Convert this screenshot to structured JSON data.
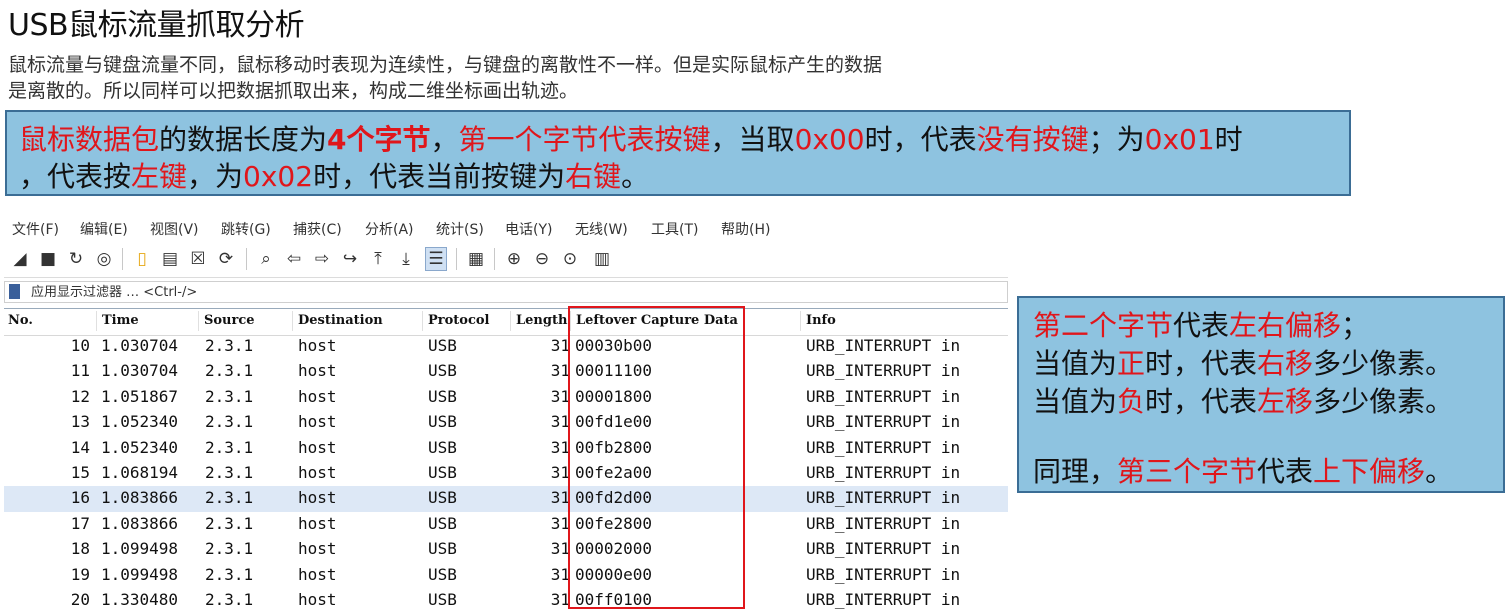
{
  "slide": {
    "title": "USB鼠标流量抓取分析",
    "intro_line1": "鼠标流量与键盘流量不同，鼠标移动时表现为连续性，与键盘的离散性不一样。但是实际鼠标产生的数据",
    "intro_line2": "是离散的。所以同样可以把数据抓取出来，构成二维坐标画出轨迹。"
  },
  "callout1": {
    "line1": [
      {
        "t": "鼠标数据包",
        "red": true
      },
      {
        "t": "的数据长度为",
        "red": false
      },
      {
        "t": "4个字节",
        "red": true,
        "bold": true
      },
      {
        "t": "，",
        "red": false
      },
      {
        "t": "第一个字节代表按键",
        "red": true
      },
      {
        "t": "，当取",
        "red": false
      },
      {
        "t": "0x00",
        "red": true
      },
      {
        "t": "时，代表",
        "red": false
      },
      {
        "t": "没有按键",
        "red": true
      },
      {
        "t": "；为",
        "red": false
      },
      {
        "t": "0x01",
        "red": true
      },
      {
        "t": "时",
        "red": false
      }
    ],
    "line2": [
      {
        "t": "，代表按",
        "red": false
      },
      {
        "t": "左键",
        "red": true
      },
      {
        "t": "，为",
        "red": false
      },
      {
        "t": "0x02",
        "red": true
      },
      {
        "t": "时，代表当前按键为",
        "red": false
      },
      {
        "t": "右键",
        "red": true
      },
      {
        "t": "。",
        "red": false
      }
    ]
  },
  "callout2": {
    "line1": [
      {
        "t": "第二个字节",
        "red": true
      },
      {
        "t": "代表",
        "red": false
      },
      {
        "t": "左右偏移",
        "red": true
      },
      {
        "t": "；",
        "red": false
      }
    ],
    "line2": [
      {
        "t": "当值为",
        "red": false
      },
      {
        "t": "正",
        "red": true
      },
      {
        "t": "时，代表",
        "red": false
      },
      {
        "t": "右移",
        "red": true
      },
      {
        "t": "多少像素。",
        "red": false
      }
    ],
    "line3": [
      {
        "t": "当值为",
        "red": false
      },
      {
        "t": "负",
        "red": true
      },
      {
        "t": "时，代表",
        "red": false
      },
      {
        "t": "左移",
        "red": true
      },
      {
        "t": "多少像素。",
        "red": false
      }
    ],
    "line4": [
      {
        "t": "同理，",
        "red": false
      },
      {
        "t": "第三个字节",
        "red": true
      },
      {
        "t": "代表",
        "red": false
      },
      {
        "t": "上下偏移",
        "red": true
      },
      {
        "t": "。",
        "red": false
      }
    ]
  },
  "menubar": [
    "文件(F)",
    "编辑(E)",
    "视图(V)",
    "跳转(G)",
    "捕获(C)",
    "分析(A)",
    "统计(S)",
    "电话(Y)",
    "无线(W)",
    "工具(T)",
    "帮助(H)"
  ],
  "toolbar": {
    "icons": [
      "shark-fin-start-icon",
      "stop-square-icon",
      "restart-fin-icon",
      "capture-options-icon",
      "open-file-icon",
      "save-file-icon",
      "close-file-icon",
      "reload-file-icon",
      "find-packet-icon",
      "go-back-icon",
      "go-forward-icon",
      "go-to-packet-icon",
      "go-first-icon",
      "go-last-icon",
      "auto-scroll-icon",
      "colorize-icon",
      "zoom-in-icon",
      "zoom-out-icon",
      "zoom-normal-icon",
      "resize-columns-icon"
    ]
  },
  "filter": {
    "placeholder": "应用显示过滤器 … <Ctrl-/>"
  },
  "packet_columns": [
    "No.",
    "Time",
    "Source",
    "Destination",
    "Protocol",
    "Length",
    "Leftover Capture Data",
    "Info"
  ],
  "packets": [
    {
      "no": "10",
      "time": "1.030704",
      "src": "2.3.1",
      "dst": "host",
      "proto": "USB",
      "len": "31",
      "data": "00030b00",
      "info": "URB_INTERRUPT in"
    },
    {
      "no": "11",
      "time": "1.030704",
      "src": "2.3.1",
      "dst": "host",
      "proto": "USB",
      "len": "31",
      "data": "00011100",
      "info": "URB_INTERRUPT in"
    },
    {
      "no": "12",
      "time": "1.051867",
      "src": "2.3.1",
      "dst": "host",
      "proto": "USB",
      "len": "31",
      "data": "00001800",
      "info": "URB_INTERRUPT in"
    },
    {
      "no": "13",
      "time": "1.052340",
      "src": "2.3.1",
      "dst": "host",
      "proto": "USB",
      "len": "31",
      "data": "00fd1e00",
      "info": "URB_INTERRUPT in"
    },
    {
      "no": "14",
      "time": "1.052340",
      "src": "2.3.1",
      "dst": "host",
      "proto": "USB",
      "len": "31",
      "data": "00fb2800",
      "info": "URB_INTERRUPT in"
    },
    {
      "no": "15",
      "time": "1.068194",
      "src": "2.3.1",
      "dst": "host",
      "proto": "USB",
      "len": "31",
      "data": "00fe2a00",
      "info": "URB_INTERRUPT in"
    },
    {
      "no": "16",
      "time": "1.083866",
      "src": "2.3.1",
      "dst": "host",
      "proto": "USB",
      "len": "31",
      "data": "00fd2d00",
      "info": "URB_INTERRUPT in",
      "selected": true
    },
    {
      "no": "17",
      "time": "1.083866",
      "src": "2.3.1",
      "dst": "host",
      "proto": "USB",
      "len": "31",
      "data": "00fe2800",
      "info": "URB_INTERRUPT in"
    },
    {
      "no": "18",
      "time": "1.099498",
      "src": "2.3.1",
      "dst": "host",
      "proto": "USB",
      "len": "31",
      "data": "00002000",
      "info": "URB_INTERRUPT in"
    },
    {
      "no": "19",
      "time": "1.099498",
      "src": "2.3.1",
      "dst": "host",
      "proto": "USB",
      "len": "31",
      "data": "00000e00",
      "info": "URB_INTERRUPT in"
    },
    {
      "no": "20",
      "time": "1.330480",
      "src": "2.3.1",
      "dst": "host",
      "proto": "USB",
      "len": "31",
      "data": "00ff0100",
      "info": "URB_INTERRUPT in"
    }
  ],
  "colors": {
    "highlight_red": "#e0161b",
    "callout_bg": "#8ec3e0",
    "callout_border": "#3b6d95",
    "selected_row": "#dde8f6"
  }
}
